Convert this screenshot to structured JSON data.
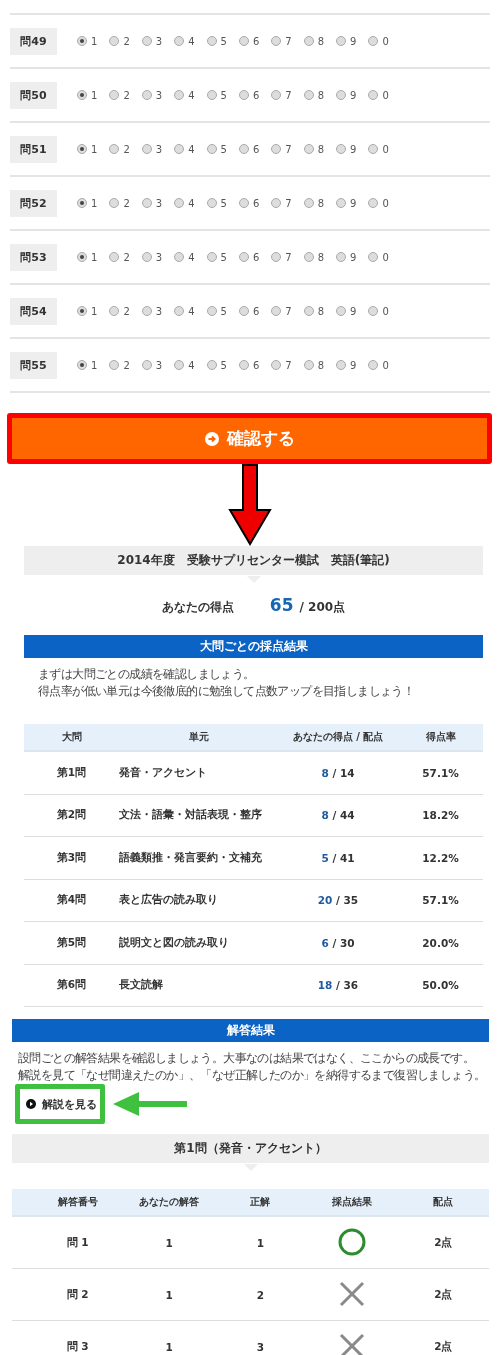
{
  "questions": [
    {
      "label": "問49",
      "options": [
        {
          "label": "1",
          "selected": true
        },
        {
          "label": "2",
          "selected": false
        },
        {
          "label": "3",
          "selected": false
        },
        {
          "label": "4",
          "selected": false
        },
        {
          "label": "5",
          "selected": false
        },
        {
          "label": "6",
          "selected": false
        },
        {
          "label": "7",
          "selected": false
        },
        {
          "label": "8",
          "selected": false
        },
        {
          "label": "9",
          "selected": false
        },
        {
          "label": "0",
          "selected": false
        }
      ]
    },
    {
      "label": "問50",
      "options": [
        {
          "label": "1",
          "selected": true
        },
        {
          "label": "2",
          "selected": false
        },
        {
          "label": "3",
          "selected": false
        },
        {
          "label": "4",
          "selected": false
        },
        {
          "label": "5",
          "selected": false
        },
        {
          "label": "6",
          "selected": false
        },
        {
          "label": "7",
          "selected": false
        },
        {
          "label": "8",
          "selected": false
        },
        {
          "label": "9",
          "selected": false
        },
        {
          "label": "0",
          "selected": false
        }
      ]
    },
    {
      "label": "問51",
      "options": [
        {
          "label": "1",
          "selected": true
        },
        {
          "label": "2",
          "selected": false
        },
        {
          "label": "3",
          "selected": false
        },
        {
          "label": "4",
          "selected": false
        },
        {
          "label": "5",
          "selected": false
        },
        {
          "label": "6",
          "selected": false
        },
        {
          "label": "7",
          "selected": false
        },
        {
          "label": "8",
          "selected": false
        },
        {
          "label": "9",
          "selected": false
        },
        {
          "label": "0",
          "selected": false
        }
      ]
    },
    {
      "label": "問52",
      "options": [
        {
          "label": "1",
          "selected": true
        },
        {
          "label": "2",
          "selected": false
        },
        {
          "label": "3",
          "selected": false
        },
        {
          "label": "4",
          "selected": false
        },
        {
          "label": "5",
          "selected": false
        },
        {
          "label": "6",
          "selected": false
        },
        {
          "label": "7",
          "selected": false
        },
        {
          "label": "8",
          "selected": false
        },
        {
          "label": "9",
          "selected": false
        },
        {
          "label": "0",
          "selected": false
        }
      ]
    },
    {
      "label": "問53",
      "options": [
        {
          "label": "1",
          "selected": true
        },
        {
          "label": "2",
          "selected": false
        },
        {
          "label": "3",
          "selected": false
        },
        {
          "label": "4",
          "selected": false
        },
        {
          "label": "5",
          "selected": false
        },
        {
          "label": "6",
          "selected": false
        },
        {
          "label": "7",
          "selected": false
        },
        {
          "label": "8",
          "selected": false
        },
        {
          "label": "9",
          "selected": false
        },
        {
          "label": "0",
          "selected": false
        }
      ]
    },
    {
      "label": "問54",
      "options": [
        {
          "label": "1",
          "selected": true
        },
        {
          "label": "2",
          "selected": false
        },
        {
          "label": "3",
          "selected": false
        },
        {
          "label": "4",
          "selected": false
        },
        {
          "label": "5",
          "selected": false
        },
        {
          "label": "6",
          "selected": false
        },
        {
          "label": "7",
          "selected": false
        },
        {
          "label": "8",
          "selected": false
        },
        {
          "label": "9",
          "selected": false
        },
        {
          "label": "0",
          "selected": false
        }
      ]
    },
    {
      "label": "問55",
      "options": [
        {
          "label": "1",
          "selected": true
        },
        {
          "label": "2",
          "selected": false
        },
        {
          "label": "3",
          "selected": false
        },
        {
          "label": "4",
          "selected": false
        },
        {
          "label": "5",
          "selected": false
        },
        {
          "label": "6",
          "selected": false
        },
        {
          "label": "7",
          "selected": false
        },
        {
          "label": "8",
          "selected": false
        },
        {
          "label": "9",
          "selected": false
        },
        {
          "label": "0",
          "selected": false
        }
      ]
    }
  ],
  "confirm_button": {
    "label": "確認する"
  },
  "exam_title": "2014年度　受験サプリセンター模試　英語(筆記)",
  "score": {
    "label": "あなたの得点",
    "value": "65",
    "total": "/ 200点"
  },
  "section_results": {
    "title": "大問ごとの採点結果",
    "intro": [
      "まずは大問ごとの成績を確認しましょう。",
      "得点率が低い単元は今後徹底的に勉強して点数アップを目指しましょう！"
    ],
    "columns": [
      "大問",
      "単元",
      "あなたの得点 / 配点",
      "得点率"
    ],
    "rows": [
      {
        "section": "第1問",
        "unit": "発音・アクセント",
        "score": "8",
        "max": "/ 14",
        "rate": "57.1%"
      },
      {
        "section": "第2問",
        "unit": "文法・語彙・対話表現・整序",
        "score": "8",
        "max": "/ 44",
        "rate": "18.2%"
      },
      {
        "section": "第3問",
        "unit": "語義類推・発言要約・文補充",
        "score": "5",
        "max": "/ 41",
        "rate": "12.2%"
      },
      {
        "section": "第4問",
        "unit": "表と広告の読み取り",
        "score": "20",
        "max": "/ 35",
        "rate": "57.1%"
      },
      {
        "section": "第5問",
        "unit": "説明文と図の読み取り",
        "score": "6",
        "max": "/ 30",
        "rate": "20.0%"
      },
      {
        "section": "第6問",
        "unit": "長文読解",
        "score": "18",
        "max": "/ 36",
        "rate": "50.0%"
      }
    ]
  },
  "answer_results": {
    "title": "解答結果",
    "intro": [
      "設問ごとの解答結果を確認しましょう。大事なのは結果ではなく、ここからの成長です。",
      "解説を見て「なぜ間違えたのか」、「なぜ正解したのか」を納得するまで復習しましょう。"
    ],
    "explanation_button": "解説を見る",
    "section_title": "第1問（発音・アクセント）",
    "columns": [
      "解答番号",
      "あなたの解答",
      "正解",
      "採点結果",
      "配点"
    ],
    "rows": [
      {
        "number": "問 1",
        "answer": "1",
        "correct": "1",
        "is_correct": true,
        "points": "2点"
      },
      {
        "number": "問 2",
        "answer": "1",
        "correct": "2",
        "is_correct": false,
        "points": "2点"
      },
      {
        "number": "問 3",
        "answer": "1",
        "correct": "3",
        "is_correct": false,
        "points": "2点"
      }
    ]
  }
}
